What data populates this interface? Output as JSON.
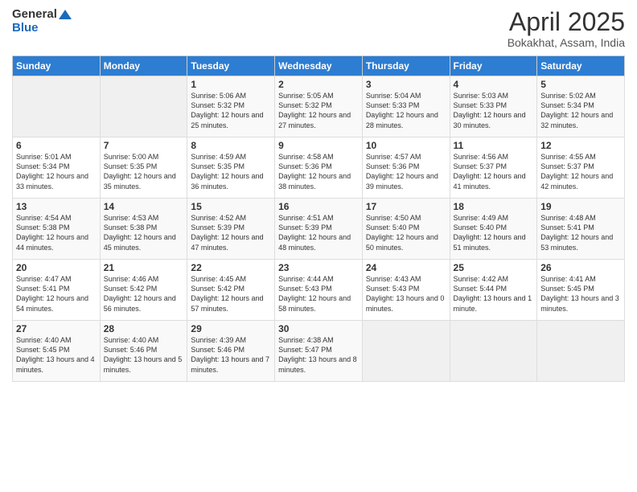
{
  "header": {
    "logo_line1": "General",
    "logo_line2": "Blue",
    "title": "April 2025",
    "subtitle": "Bokakhat, Assam, India"
  },
  "days_of_week": [
    "Sunday",
    "Monday",
    "Tuesday",
    "Wednesday",
    "Thursday",
    "Friday",
    "Saturday"
  ],
  "weeks": [
    [
      {
        "day": "",
        "sunrise": "",
        "sunset": "",
        "daylight": "",
        "empty": true
      },
      {
        "day": "",
        "sunrise": "",
        "sunset": "",
        "daylight": "",
        "empty": true
      },
      {
        "day": "1",
        "sunrise": "Sunrise: 5:06 AM",
        "sunset": "Sunset: 5:32 PM",
        "daylight": "Daylight: 12 hours and 25 minutes."
      },
      {
        "day": "2",
        "sunrise": "Sunrise: 5:05 AM",
        "sunset": "Sunset: 5:32 PM",
        "daylight": "Daylight: 12 hours and 27 minutes."
      },
      {
        "day": "3",
        "sunrise": "Sunrise: 5:04 AM",
        "sunset": "Sunset: 5:33 PM",
        "daylight": "Daylight: 12 hours and 28 minutes."
      },
      {
        "day": "4",
        "sunrise": "Sunrise: 5:03 AM",
        "sunset": "Sunset: 5:33 PM",
        "daylight": "Daylight: 12 hours and 30 minutes."
      },
      {
        "day": "5",
        "sunrise": "Sunrise: 5:02 AM",
        "sunset": "Sunset: 5:34 PM",
        "daylight": "Daylight: 12 hours and 32 minutes."
      }
    ],
    [
      {
        "day": "6",
        "sunrise": "Sunrise: 5:01 AM",
        "sunset": "Sunset: 5:34 PM",
        "daylight": "Daylight: 12 hours and 33 minutes."
      },
      {
        "day": "7",
        "sunrise": "Sunrise: 5:00 AM",
        "sunset": "Sunset: 5:35 PM",
        "daylight": "Daylight: 12 hours and 35 minutes."
      },
      {
        "day": "8",
        "sunrise": "Sunrise: 4:59 AM",
        "sunset": "Sunset: 5:35 PM",
        "daylight": "Daylight: 12 hours and 36 minutes."
      },
      {
        "day": "9",
        "sunrise": "Sunrise: 4:58 AM",
        "sunset": "Sunset: 5:36 PM",
        "daylight": "Daylight: 12 hours and 38 minutes."
      },
      {
        "day": "10",
        "sunrise": "Sunrise: 4:57 AM",
        "sunset": "Sunset: 5:36 PM",
        "daylight": "Daylight: 12 hours and 39 minutes."
      },
      {
        "day": "11",
        "sunrise": "Sunrise: 4:56 AM",
        "sunset": "Sunset: 5:37 PM",
        "daylight": "Daylight: 12 hours and 41 minutes."
      },
      {
        "day": "12",
        "sunrise": "Sunrise: 4:55 AM",
        "sunset": "Sunset: 5:37 PM",
        "daylight": "Daylight: 12 hours and 42 minutes."
      }
    ],
    [
      {
        "day": "13",
        "sunrise": "Sunrise: 4:54 AM",
        "sunset": "Sunset: 5:38 PM",
        "daylight": "Daylight: 12 hours and 44 minutes."
      },
      {
        "day": "14",
        "sunrise": "Sunrise: 4:53 AM",
        "sunset": "Sunset: 5:38 PM",
        "daylight": "Daylight: 12 hours and 45 minutes."
      },
      {
        "day": "15",
        "sunrise": "Sunrise: 4:52 AM",
        "sunset": "Sunset: 5:39 PM",
        "daylight": "Daylight: 12 hours and 47 minutes."
      },
      {
        "day": "16",
        "sunrise": "Sunrise: 4:51 AM",
        "sunset": "Sunset: 5:39 PM",
        "daylight": "Daylight: 12 hours and 48 minutes."
      },
      {
        "day": "17",
        "sunrise": "Sunrise: 4:50 AM",
        "sunset": "Sunset: 5:40 PM",
        "daylight": "Daylight: 12 hours and 50 minutes."
      },
      {
        "day": "18",
        "sunrise": "Sunrise: 4:49 AM",
        "sunset": "Sunset: 5:40 PM",
        "daylight": "Daylight: 12 hours and 51 minutes."
      },
      {
        "day": "19",
        "sunrise": "Sunrise: 4:48 AM",
        "sunset": "Sunset: 5:41 PM",
        "daylight": "Daylight: 12 hours and 53 minutes."
      }
    ],
    [
      {
        "day": "20",
        "sunrise": "Sunrise: 4:47 AM",
        "sunset": "Sunset: 5:41 PM",
        "daylight": "Daylight: 12 hours and 54 minutes."
      },
      {
        "day": "21",
        "sunrise": "Sunrise: 4:46 AM",
        "sunset": "Sunset: 5:42 PM",
        "daylight": "Daylight: 12 hours and 56 minutes."
      },
      {
        "day": "22",
        "sunrise": "Sunrise: 4:45 AM",
        "sunset": "Sunset: 5:42 PM",
        "daylight": "Daylight: 12 hours and 57 minutes."
      },
      {
        "day": "23",
        "sunrise": "Sunrise: 4:44 AM",
        "sunset": "Sunset: 5:43 PM",
        "daylight": "Daylight: 12 hours and 58 minutes."
      },
      {
        "day": "24",
        "sunrise": "Sunrise: 4:43 AM",
        "sunset": "Sunset: 5:43 PM",
        "daylight": "Daylight: 13 hours and 0 minutes."
      },
      {
        "day": "25",
        "sunrise": "Sunrise: 4:42 AM",
        "sunset": "Sunset: 5:44 PM",
        "daylight": "Daylight: 13 hours and 1 minute."
      },
      {
        "day": "26",
        "sunrise": "Sunrise: 4:41 AM",
        "sunset": "Sunset: 5:45 PM",
        "daylight": "Daylight: 13 hours and 3 minutes."
      }
    ],
    [
      {
        "day": "27",
        "sunrise": "Sunrise: 4:40 AM",
        "sunset": "Sunset: 5:45 PM",
        "daylight": "Daylight: 13 hours and 4 minutes."
      },
      {
        "day": "28",
        "sunrise": "Sunrise: 4:40 AM",
        "sunset": "Sunset: 5:46 PM",
        "daylight": "Daylight: 13 hours and 5 minutes."
      },
      {
        "day": "29",
        "sunrise": "Sunrise: 4:39 AM",
        "sunset": "Sunset: 5:46 PM",
        "daylight": "Daylight: 13 hours and 7 minutes."
      },
      {
        "day": "30",
        "sunrise": "Sunrise: 4:38 AM",
        "sunset": "Sunset: 5:47 PM",
        "daylight": "Daylight: 13 hours and 8 minutes."
      },
      {
        "day": "",
        "sunrise": "",
        "sunset": "",
        "daylight": "",
        "empty": true
      },
      {
        "day": "",
        "sunrise": "",
        "sunset": "",
        "daylight": "",
        "empty": true
      },
      {
        "day": "",
        "sunrise": "",
        "sunset": "",
        "daylight": "",
        "empty": true
      }
    ]
  ]
}
